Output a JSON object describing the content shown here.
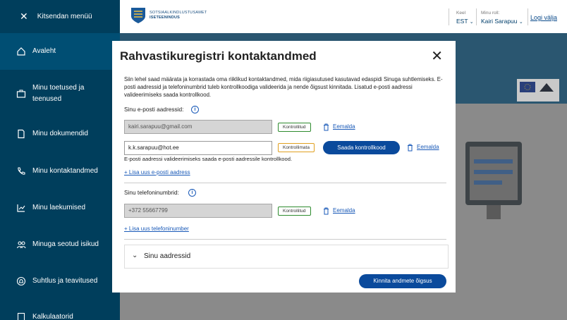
{
  "sidebar": {
    "close_menu_label": "Kitsendan menüü",
    "items": [
      {
        "label": "Avaleht",
        "icon": "home-icon"
      },
      {
        "label": "Minu toetused ja teenused",
        "icon": "briefcase-icon"
      },
      {
        "label": "Minu dokumendid",
        "icon": "document-icon"
      },
      {
        "label": "Minu kontaktandmed",
        "icon": "phone-icon"
      },
      {
        "label": "Minu laekumised",
        "icon": "chart-icon"
      },
      {
        "label": "Minuga seotud isikud",
        "icon": "people-icon"
      },
      {
        "label": "Suhtlus ja teavitused",
        "icon": "bell-icon"
      },
      {
        "label": "Kalkulaatorid",
        "icon": "calculator-icon"
      }
    ]
  },
  "header": {
    "logo_line1": "SOTSIAALKINDLUSTUSAMET",
    "logo_line2": "ISETEENINDUS",
    "language_label": "Keel",
    "language_value": "EST",
    "role_label": "Minu roll:",
    "role_value": "Kairi Sarapuu",
    "logout_label": "Logi välja"
  },
  "modal": {
    "title": "Rahvastikuregistri kontaktandmed",
    "intro": "Siin lehel saad määrata ja korrastada oma riiklikud kontaktandmed, mida riigiasutused kasutavad edaspidi Sinuga suhtlemiseks. E-posti aadressid ja telefoninumbrid tuleb kontrollkoodiga valideerida ja nende õigsust kinnitada. Lisatud e-posti aadressi valideerimiseks saada kontrollkood.",
    "email_section_label": "Sinu e-posti aadressid:",
    "emails": [
      {
        "value": "kairi.sarapuu@gmail.com",
        "status": "Kontrollitud",
        "remove": "Eemalda"
      },
      {
        "value": "k.k.sarapuu@hot.ee",
        "status": "Kontrollimata",
        "send_code": "Saada kontrollkood",
        "remove": "Eemalda"
      }
    ],
    "email_helper": "E-posti aadressi valideerimiseks saada e-posti aadressile kontrollkood.",
    "add_email": "+ Lisa uus e-posti aadress",
    "phone_section_label": "Sinu telefoninumbrid:",
    "phones": [
      {
        "value": "+372 55667799",
        "status": "Kontrollitud",
        "remove": "Eemalda"
      }
    ],
    "add_phone": "+ Lisa uus telefoninumber",
    "addresses_label": "Sinu aadressid",
    "confirm_button": "Kinnita andmete õigsus"
  },
  "colors": {
    "sidebar_bg": "#003e5c",
    "primary": "#0a4a9c",
    "verified": "#2e8b2e",
    "unverified": "#e0a020"
  }
}
